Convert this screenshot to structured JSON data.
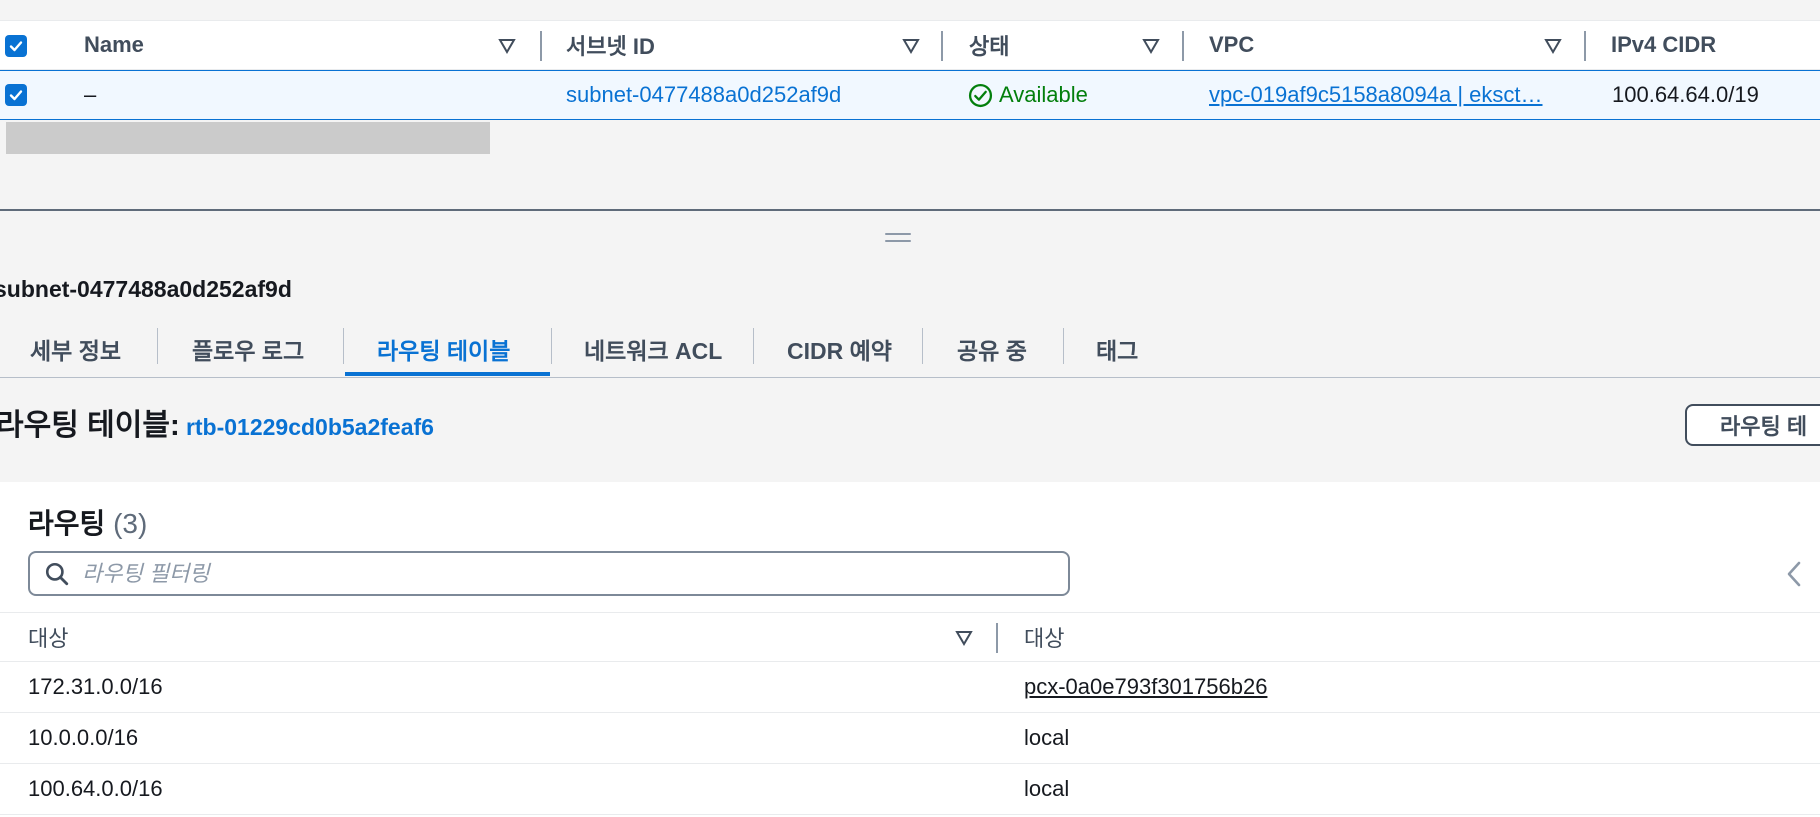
{
  "subnet_table": {
    "columns": [
      "Name",
      "서브넷 ID",
      "상태",
      "VPC",
      "IPv4 CIDR"
    ],
    "row": {
      "name": "–",
      "subnet_id": "subnet-0477488a0d252af9d",
      "status": "Available",
      "vpc": "vpc-019af9c5158a8094a | eksct…",
      "ipv4_cidr": "100.64.64.0/19"
    }
  },
  "details": {
    "title": "subnet-0477488a0d252af9d",
    "tabs": [
      "세부 정보",
      "플로우 로그",
      "라우팅 테이블",
      "네트워크 ACL",
      "CIDR 예약",
      "공유 중",
      "태그"
    ],
    "active_tab": "라우팅 테이블",
    "route_table_label": "라우팅 테이블:",
    "route_table_id": "rtb-01229cd0b5a2feaf6",
    "edit_button": "라우팅 테"
  },
  "routes": {
    "title": "라우팅",
    "count": "(3)",
    "search_placeholder": "라우팅 필터링",
    "columns": [
      "대상",
      "대상"
    ],
    "rows": [
      {
        "destination": "172.31.0.0/16",
        "target": "pcx-0a0e793f301756b26"
      },
      {
        "destination": "10.0.0.0/16",
        "target": "local"
      },
      {
        "destination": "100.64.0.0/16",
        "target": "local"
      }
    ]
  },
  "colors": {
    "accent": "#0972d3",
    "status_green": "#037f0c",
    "selected_row_bg": "#f1f8ff"
  }
}
